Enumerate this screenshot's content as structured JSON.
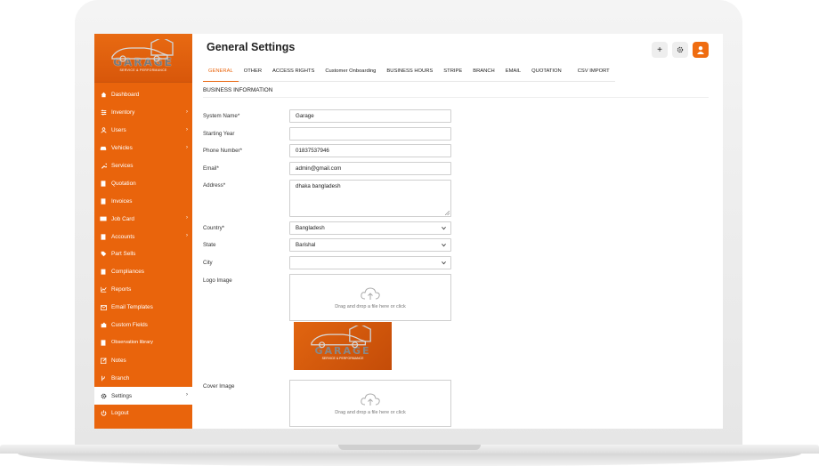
{
  "page": {
    "title": "General Settings"
  },
  "brand": {
    "logo_text": "GARAGE",
    "logo_subtext": "SERVICE & PERFORMANCE",
    "accent_color": "#e9640c"
  },
  "sidebar": {
    "items": [
      {
        "label": "Dashboard",
        "icon": "home-icon",
        "chevron": false
      },
      {
        "label": "Inventory",
        "icon": "sliders-icon",
        "chevron": true
      },
      {
        "label": "Users",
        "icon": "user-icon",
        "chevron": true
      },
      {
        "label": "Vehicles",
        "icon": "car-icon",
        "chevron": true
      },
      {
        "label": "Services",
        "icon": "wrench-icon",
        "chevron": false
      },
      {
        "label": "Quotation",
        "icon": "document-icon",
        "chevron": false
      },
      {
        "label": "Invoices",
        "icon": "invoice-icon",
        "chevron": false
      },
      {
        "label": "Job Card",
        "icon": "card-icon",
        "chevron": true
      },
      {
        "label": "Accounts",
        "icon": "ledger-icon",
        "chevron": true
      },
      {
        "label": "Part Sells",
        "icon": "tag-icon",
        "chevron": false
      },
      {
        "label": "Compliances",
        "icon": "clipboard-icon",
        "chevron": false
      },
      {
        "label": "Reports",
        "icon": "chart-icon",
        "chevron": false
      },
      {
        "label": "Email Templates",
        "icon": "mail-icon",
        "chevron": false
      },
      {
        "label": "Custom Fields",
        "icon": "puzzle-icon",
        "chevron": false
      },
      {
        "label": "Observation library",
        "icon": "book-icon",
        "chevron": false
      },
      {
        "label": "Notes",
        "icon": "edit-icon",
        "chevron": false
      },
      {
        "label": "Branch",
        "icon": "branch-icon",
        "chevron": false
      },
      {
        "label": "Settings",
        "icon": "gear-icon",
        "chevron": true
      },
      {
        "label": "Logout",
        "icon": "power-icon",
        "chevron": false
      }
    ],
    "active": "Settings"
  },
  "tabs": [
    "GENERAL",
    "OTHER",
    "ACCESS RIGHTS",
    "Customer Onboarding",
    "BUSINESS HOURS",
    "STRIPE",
    "BRANCH",
    "EMAIL",
    "QUOTATION",
    "CSV IMPORT"
  ],
  "active_tab": "GENERAL",
  "section": {
    "title": "BUSINESS INFORMATION"
  },
  "form": {
    "system_name": {
      "label": "System Name*",
      "value": "Garage"
    },
    "starting_year": {
      "label": "Starting Year",
      "value": ""
    },
    "phone": {
      "label": "Phone Number*",
      "value": "01837537946"
    },
    "email": {
      "label": "Email*",
      "value": "admin@gmail.com"
    },
    "address": {
      "label": "Address*",
      "value": "dhaka bangladesh"
    },
    "country": {
      "label": "Country*",
      "value": "Bangladesh"
    },
    "state": {
      "label": "State",
      "value": "Barishal"
    },
    "city": {
      "label": "City",
      "value": ""
    },
    "logo_image": {
      "label": "Logo Image",
      "drop_text": "Drag and drop a file here or click"
    },
    "cover_image": {
      "label": "Cover Image",
      "drop_text": "Drag and drop a file here or click"
    }
  }
}
